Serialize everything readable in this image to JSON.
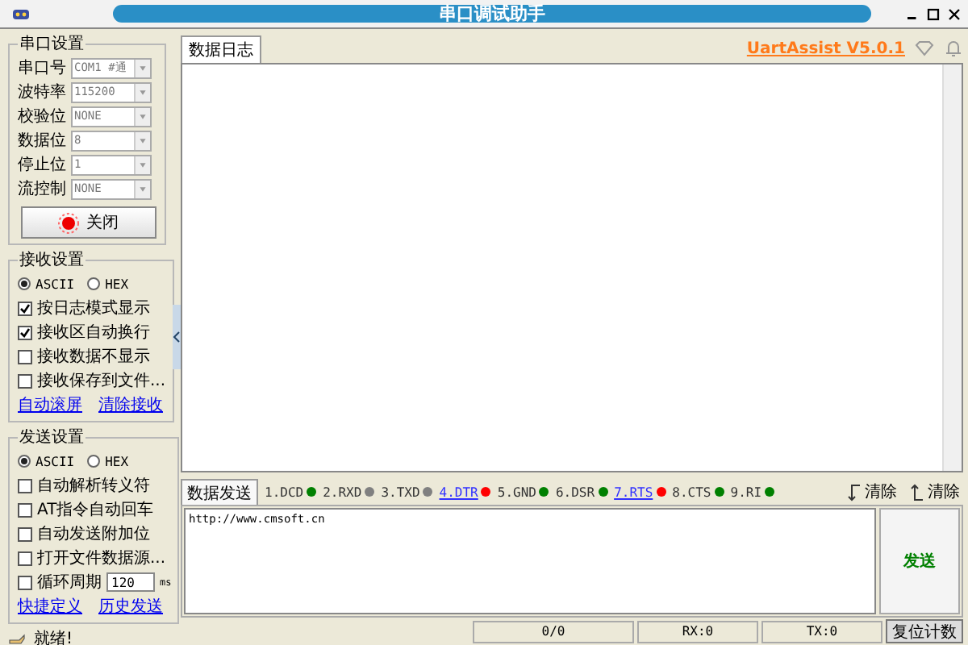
{
  "window": {
    "title": "串口调试助手"
  },
  "serial_settings": {
    "title": "串口设置",
    "fields": [
      {
        "label": "串口号",
        "value": "COM1 #通"
      },
      {
        "label": "波特率",
        "value": "115200"
      },
      {
        "label": "校验位",
        "value": "NONE"
      },
      {
        "label": "数据位",
        "value": "8"
      },
      {
        "label": "停止位",
        "value": "1"
      },
      {
        "label": "流控制",
        "value": "NONE"
      }
    ],
    "button": {
      "label": "关闭",
      "on": true
    }
  },
  "receive_settings": {
    "title": "接收设置",
    "modes": [
      {
        "label": "ASCII",
        "selected": true
      },
      {
        "label": "HEX",
        "selected": false
      }
    ],
    "options": [
      {
        "label": "按日志模式显示",
        "checked": true
      },
      {
        "label": "接收区自动换行",
        "checked": true
      },
      {
        "label": "接收数据不显示",
        "checked": false
      },
      {
        "label": "接收保存到文件...",
        "checked": false
      }
    ],
    "links": [
      "自动滚屏",
      "清除接收"
    ]
  },
  "send_settings": {
    "title": "发送设置",
    "modes": [
      {
        "label": "ASCII",
        "selected": true
      },
      {
        "label": "HEX",
        "selected": false
      }
    ],
    "options": [
      {
        "label": "自动解析转义符",
        "checked": false
      },
      {
        "label": "AT指令自动回车",
        "checked": false
      },
      {
        "label": "自动发送附加位",
        "checked": false
      },
      {
        "label": "打开文件数据源...",
        "checked": false
      }
    ],
    "cycle": {
      "label": "循环周期",
      "checked": false,
      "value": "120",
      "unit": "ms"
    },
    "links": [
      "快捷定义",
      "历史发送"
    ]
  },
  "status": "就绪!",
  "log": {
    "tab": "数据日志",
    "brand": "UartAssist V5.0.1"
  },
  "send": {
    "tab": "数据发送",
    "pins": [
      {
        "label": "1.DCD",
        "kind": "plain",
        "color": "#008000"
      },
      {
        "label": "2.RXD",
        "kind": "plain",
        "color": "#808080"
      },
      {
        "label": "3.TXD",
        "kind": "plain",
        "color": "#808080"
      },
      {
        "label": "4.DTR",
        "kind": "link",
        "color": "#ff0000"
      },
      {
        "label": "5.GND",
        "kind": "plain",
        "color": "#008000"
      },
      {
        "label": "6.DSR",
        "kind": "plain",
        "color": "#008000"
      },
      {
        "label": "7.RTS",
        "kind": "link",
        "color": "#ff0000"
      },
      {
        "label": "8.CTS",
        "kind": "plain",
        "color": "#008000"
      },
      {
        "label": "9.RI",
        "kind": "plain",
        "color": "#008000"
      }
    ],
    "clear_buttons": [
      "清除",
      "清除"
    ],
    "text": "http://www.cmsoft.cn",
    "button": "发送"
  },
  "status_bar": {
    "counter": "0/0",
    "rx": "RX:0",
    "tx": "TX:0",
    "reset": "复位计数"
  }
}
